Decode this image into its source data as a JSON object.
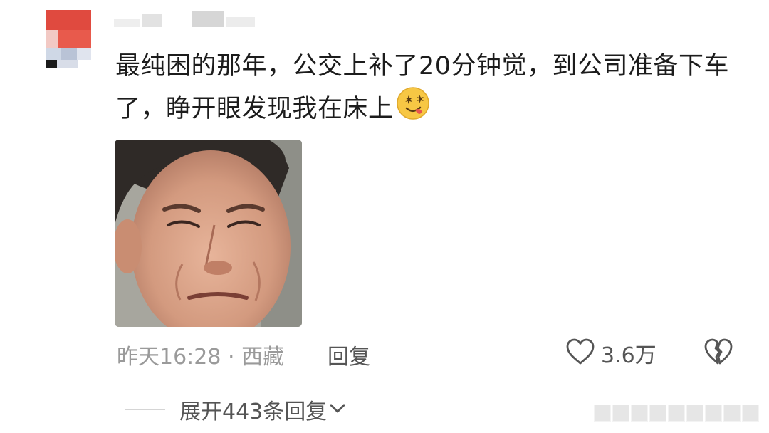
{
  "comment": {
    "text": "最纯困的那年，公交上补了20分钟觉，到公司准备下车了，睁开眼发现我在床上",
    "emoji_icon": "drooling-face-emoji",
    "sticker_icon": "squinting-man-meme-sticker",
    "time": "昨天16:28",
    "separator": "·",
    "location": "西藏",
    "reply_label": "回复",
    "like_count": "3.6万",
    "expand_replies_label": "展开443条回复"
  },
  "icons": {
    "like": "heart-outline-icon",
    "dislike": "broken-heart-icon",
    "expand": "chevron-down-icon"
  },
  "colors": {
    "text": "#1c1c1c",
    "meta": "#9a9a9a",
    "action": "#555555",
    "avatar_red": "#e04a3f"
  }
}
